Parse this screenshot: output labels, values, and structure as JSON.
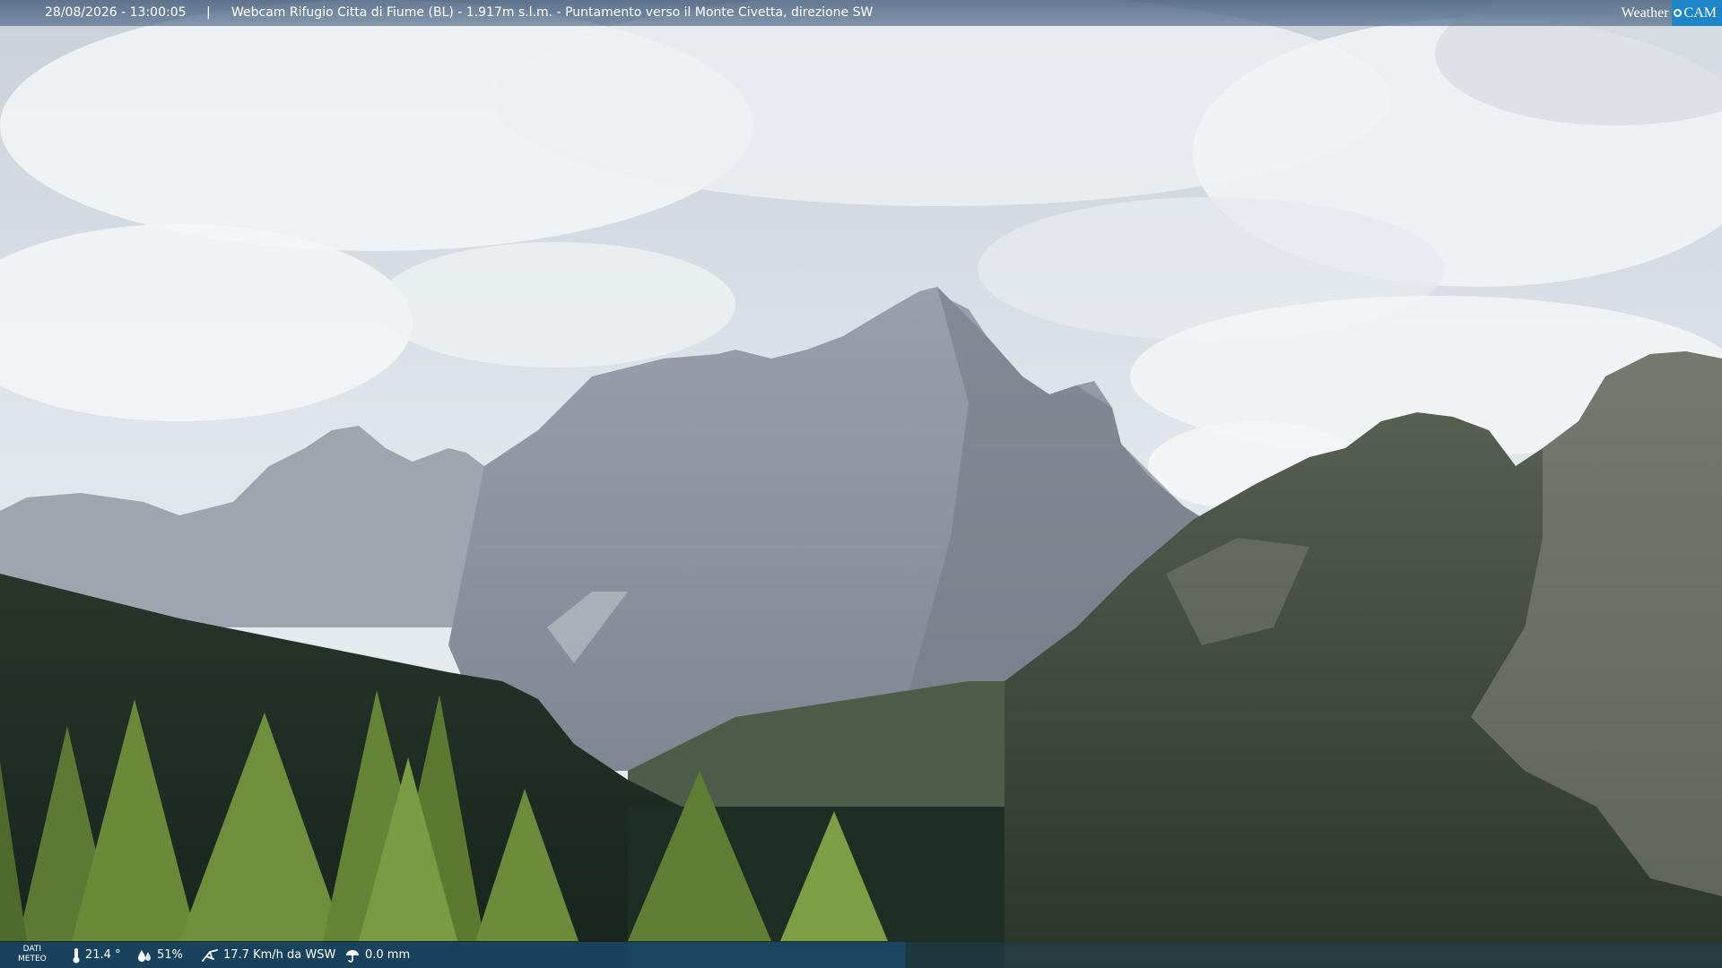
{
  "header": {
    "timestamp": "28/08/2026 - 13:00:05",
    "separator": "|",
    "caption": "Webcam Rifugio Citta di Fiume (BL) - 1.917m s.l.m. - Puntamento verso il Monte Civetta, direzione SW"
  },
  "logo": {
    "weather": "Weather",
    "cam": "CAM",
    "accent_color": "#1e86c8"
  },
  "footer": {
    "label_line1": "DATI",
    "label_line2": "METEO",
    "temperature": "21.4 °",
    "humidity": "51%",
    "wind": "17.7 Km/h da WSW",
    "rain": "0.0 mm",
    "icons": [
      "thermometer-icon",
      "humidity-drop-icon",
      "wind-icon",
      "rain-umbrella-icon"
    ]
  }
}
